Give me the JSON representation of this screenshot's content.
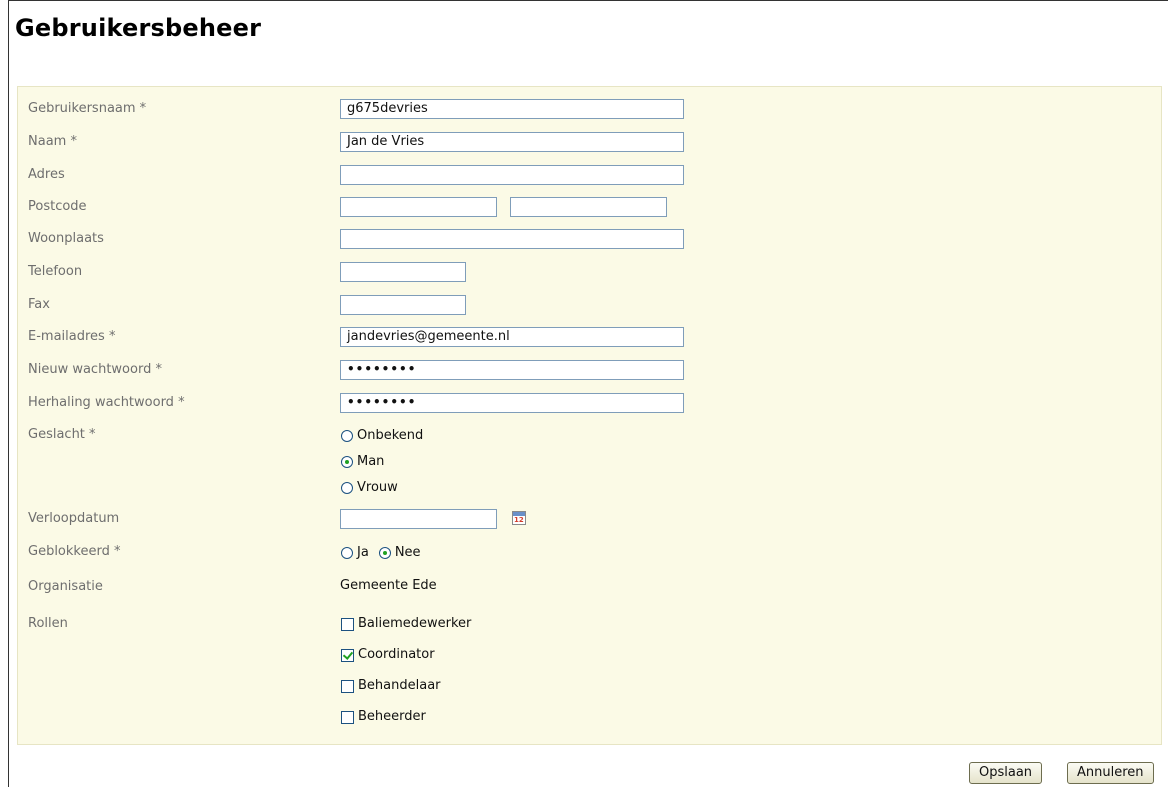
{
  "page": {
    "title": "Gebruikersbeheer"
  },
  "form": {
    "username": {
      "label": "Gebruikersnaam *",
      "value": "g675devries"
    },
    "name": {
      "label": "Naam *",
      "value": "Jan de Vries"
    },
    "address": {
      "label": "Adres",
      "value": ""
    },
    "postcode": {
      "label": "Postcode",
      "value1": "",
      "value2": ""
    },
    "city": {
      "label": "Woonplaats",
      "value": ""
    },
    "phone": {
      "label": "Telefoon",
      "value": ""
    },
    "fax": {
      "label": "Fax",
      "value": ""
    },
    "email": {
      "label": "E-mailadres *",
      "value": "jandevries@gemeente.nl"
    },
    "new_password": {
      "label": "Nieuw wachtwoord *",
      "value": "••••••••"
    },
    "repeat_password": {
      "label": "Herhaling wachtwoord *",
      "value": "••••••••"
    },
    "gender": {
      "label": "Geslacht *",
      "options": [
        "Onbekend",
        "Man",
        "Vrouw"
      ],
      "selected": "Man"
    },
    "expiry": {
      "label": "Verloopdatum",
      "value": "",
      "calendar_icon": "calendar-icon",
      "calendar_day": "12"
    },
    "blocked": {
      "label": "Geblokkeerd *",
      "options": [
        "Ja",
        "Nee"
      ],
      "selected": "Nee"
    },
    "organisation": {
      "label": "Organisatie",
      "value": "Gemeente Ede"
    },
    "roles": {
      "label": "Rollen",
      "items": [
        {
          "label": "Baliemedewerker",
          "checked": false
        },
        {
          "label": "Coordinator",
          "checked": true
        },
        {
          "label": "Behandelaar",
          "checked": false
        },
        {
          "label": "Beheerder",
          "checked": false
        }
      ]
    }
  },
  "actions": {
    "save_label": "Opslaan",
    "cancel_label": "Annuleren"
  },
  "colors": {
    "panel_background": "#fbfae6",
    "input_border": "#7f9db9",
    "check_mark": "#21a121",
    "label_text": "#6e6e6e"
  }
}
